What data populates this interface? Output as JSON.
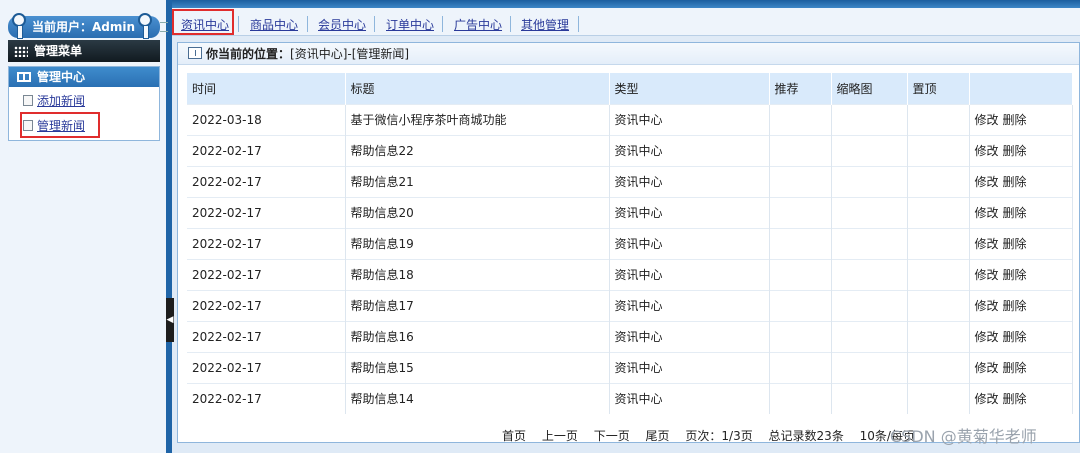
{
  "sidebar": {
    "user_label": "当前用户：Admin",
    "menu_title": "管理菜单",
    "panel_title": "管理中心",
    "items": [
      {
        "label": "添加新闻"
      },
      {
        "label": "管理新闻"
      }
    ]
  },
  "nav": {
    "tabs": [
      {
        "label": "资讯中心"
      },
      {
        "label": "商品中心"
      },
      {
        "label": "会员中心"
      },
      {
        "label": "订单中心"
      },
      {
        "label": "广告中心"
      },
      {
        "label": "其他管理"
      }
    ]
  },
  "breadcrumb": {
    "prefix": "你当前的位置：",
    "path": "[资讯中心]-[管理新闻]"
  },
  "table": {
    "headers": [
      "时间",
      "标题",
      "类型",
      "推荐",
      "缩略图",
      "置顶",
      ""
    ],
    "edit_label": "修改",
    "delete_label": "删除",
    "rows": [
      {
        "time": "2022-03-18",
        "title": "基于微信小程序茶叶商城功能",
        "type": "资讯中心"
      },
      {
        "time": "2022-02-17",
        "title": "帮助信息22",
        "type": "资讯中心"
      },
      {
        "time": "2022-02-17",
        "title": "帮助信息21",
        "type": "资讯中心"
      },
      {
        "time": "2022-02-17",
        "title": "帮助信息20",
        "type": "资讯中心"
      },
      {
        "time": "2022-02-17",
        "title": "帮助信息19",
        "type": "资讯中心"
      },
      {
        "time": "2022-02-17",
        "title": "帮助信息18",
        "type": "资讯中心"
      },
      {
        "time": "2022-02-17",
        "title": "帮助信息17",
        "type": "资讯中心"
      },
      {
        "time": "2022-02-17",
        "title": "帮助信息16",
        "type": "资讯中心"
      },
      {
        "time": "2022-02-17",
        "title": "帮助信息15",
        "type": "资讯中心"
      },
      {
        "time": "2022-02-17",
        "title": "帮助信息14",
        "type": "资讯中心"
      }
    ]
  },
  "pager": {
    "first": "首页",
    "prev": "上一页",
    "next": "下一页",
    "last": "尾页",
    "page_info": "页次：1/3页",
    "total": "总记录数23条",
    "per_page": "10条/每页"
  },
  "watermark": "CSDN @黄菊华老师",
  "colors": {
    "accent": "#2a70b3",
    "highlight_border": "#e02d2d",
    "header_bg": "#d9eafb"
  }
}
